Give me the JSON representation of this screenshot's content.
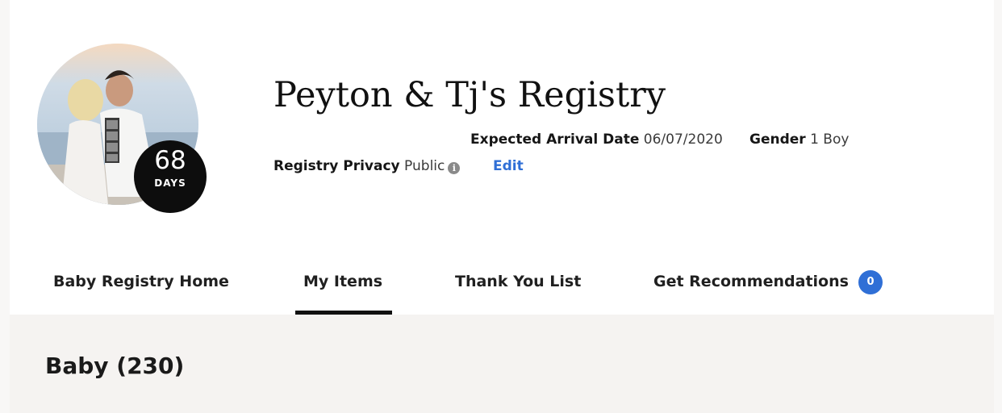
{
  "registry": {
    "title": "Peyton & Tj's Registry",
    "countdown": {
      "number": "68",
      "unit": "DAYS"
    },
    "expected_arrival": {
      "label": "Expected Arrival Date",
      "value": "06/07/2020"
    },
    "gender": {
      "label": "Gender",
      "value": "1 Boy"
    },
    "privacy": {
      "label": "Registry Privacy",
      "value": "Public"
    },
    "edit_label": "Edit"
  },
  "tabs": [
    {
      "label": "Baby Registry Home",
      "active": false
    },
    {
      "label": "My Items",
      "active": true
    },
    {
      "label": "Thank You List",
      "active": false
    },
    {
      "label": "Get Recommendations",
      "active": false,
      "badge": "0"
    }
  ],
  "section": {
    "title": "Baby (230)"
  },
  "icons": {
    "privacy_info": "info-icon",
    "profile": "avatar-photo"
  },
  "colors": {
    "accent": "#2f6fd6",
    "badge_dark": "#0d0d0d",
    "content_bg": "#f5f3f1"
  }
}
